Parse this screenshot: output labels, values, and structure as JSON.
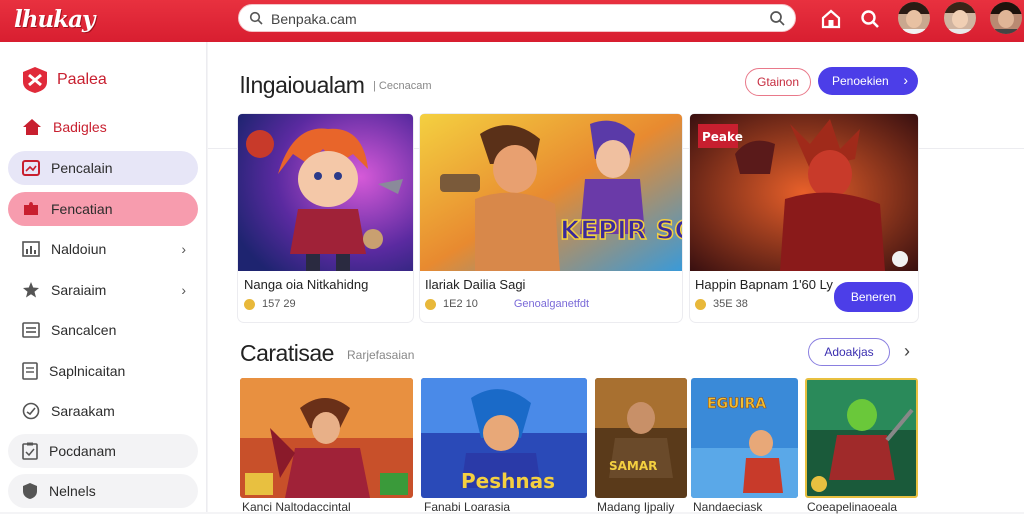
{
  "app": {
    "logo": "lhukay"
  },
  "search": {
    "query": "Benpaka.cam"
  },
  "header": {
    "icons": [
      "home-icon",
      "search-icon"
    ],
    "avatars": 3
  },
  "sidebar": {
    "brand": "Paalea",
    "items": [
      {
        "label": "Badigles",
        "icon": "home-icon"
      },
      {
        "label": "Pencalain",
        "icon": "picture-icon"
      },
      {
        "label": "Fencatian",
        "icon": "puzzle-icon"
      },
      {
        "label": "Naldoiun",
        "icon": "chart-icon"
      },
      {
        "label": "Saraiaim",
        "icon": "star-icon"
      },
      {
        "label": "Sancalcen",
        "icon": "list-icon"
      },
      {
        "label": "Saplnicaitan",
        "icon": "document-icon"
      },
      {
        "label": "Saraakam",
        "icon": "gauge-icon"
      },
      {
        "label": "Pocdanam",
        "icon": "clipboard-icon"
      },
      {
        "label": "Nelnels",
        "icon": "shield-icon"
      }
    ]
  },
  "section1": {
    "title": "lIngaioualam",
    "subtitle": "| Cecnacam",
    "btn_outline": "Gtainon",
    "btn_primary": "Penoekien",
    "btn_primary_arrow": "›",
    "cards": [
      {
        "title": "Nanga oia Nitkahidng",
        "meta": "157 29"
      },
      {
        "title": "Ilariak Dailia Sagi",
        "meta": "1E2 10",
        "meta2": "Genoalganetfdt",
        "art_text": "KEPIR SCI FOSIASI"
      },
      {
        "title": "Happin Bapnam 1'60 Ly",
        "meta": "35E 38",
        "button": "Beneren",
        "badge": "Peake"
      }
    ]
  },
  "section2": {
    "title": "Caratisae",
    "subtitle": "Rarjefasaian",
    "btn_outline": "Adoakjas",
    "arrow": "›",
    "thumbs": [
      {
        "title": "Kanci Naltodaccintal"
      },
      {
        "title": "Fanabi Loarasia",
        "art_text": "Peshnas"
      },
      {
        "title": "Madang Ijpaliy",
        "art_text": "SAMAR"
      },
      {
        "title": "Nandaeciask",
        "art_text": "EGUIRA"
      },
      {
        "title": "Coeapelinaoeala"
      }
    ]
  },
  "colors": {
    "accent": "#d81e30",
    "primary": "#4c3ee8"
  }
}
